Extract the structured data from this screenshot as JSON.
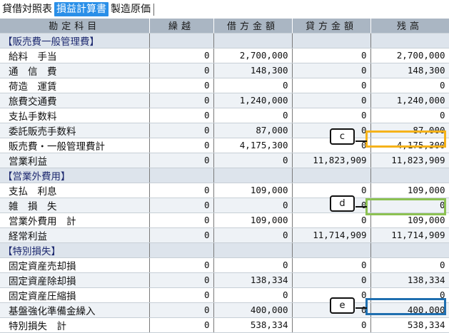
{
  "tabs": [
    {
      "label": "貸借対照表",
      "active": false
    },
    {
      "label": "損益計算書",
      "active": true
    },
    {
      "label": "製造原価",
      "active": false
    }
  ],
  "columns": [
    "勘定科目",
    "繰越",
    "借方金額",
    "貸方金額",
    "残高"
  ],
  "rows": [
    {
      "type": "section",
      "label": "【販売費一般管理費】"
    },
    {
      "label": "給料　手当",
      "c1": "0",
      "c2": "2,700,000",
      "c3": "0",
      "c4": "2,700,000"
    },
    {
      "label": "通　信　費",
      "c1": "0",
      "c2": "148,300",
      "c3": "0",
      "c4": "148,300"
    },
    {
      "label": "荷造　運賃",
      "c1": "0",
      "c2": "0",
      "c3": "0",
      "c4": "0"
    },
    {
      "label": "旅費交通費",
      "c1": "0",
      "c2": "1,240,000",
      "c3": "0",
      "c4": "1,240,000"
    },
    {
      "label": "支払手数料",
      "c1": "0",
      "c2": "0",
      "c3": "0",
      "c4": "0"
    },
    {
      "label": "委託販売手数料",
      "c1": "0",
      "c2": "87,000",
      "c3": "0",
      "c4": "87,000"
    },
    {
      "label": "販売費・一般管理費計",
      "c1": "0",
      "c2": "4,175,300",
      "c3": "0",
      "c4": "4,175,300"
    },
    {
      "label": "営業利益",
      "c1": "0",
      "c2": "0",
      "c3": "11,823,909",
      "c4": "11,823,909"
    },
    {
      "type": "section",
      "label": "【営業外費用】"
    },
    {
      "label": "支払　利息",
      "c1": "0",
      "c2": "109,000",
      "c3": "0",
      "c4": "109,000"
    },
    {
      "label": "雑　損　失",
      "c1": "0",
      "c2": "0",
      "c3": "0",
      "c4": "0"
    },
    {
      "label": "営業外費用　計",
      "c1": "0",
      "c2": "109,000",
      "c3": "0",
      "c4": "109,000"
    },
    {
      "label": "経常利益",
      "c1": "0",
      "c2": "0",
      "c3": "11,714,909",
      "c4": "11,714,909"
    },
    {
      "type": "section",
      "label": "【特別損失】"
    },
    {
      "label": "固定資産売却損",
      "c1": "0",
      "c2": "0",
      "c3": "0",
      "c4": "0"
    },
    {
      "label": "固定資産除却損",
      "c1": "0",
      "c2": "138,334",
      "c3": "0",
      "c4": "138,334"
    },
    {
      "label": "固定資産圧縮損",
      "c1": "0",
      "c2": "0",
      "c3": "0",
      "c4": "0"
    },
    {
      "label": "基盤強化準備金繰入",
      "c1": "0",
      "c2": "400,000",
      "c3": "0",
      "c4": "400,000"
    },
    {
      "label": "特別損失　計",
      "c1": "0",
      "c2": "538,334",
      "c3": "0",
      "c4": "538,334"
    }
  ],
  "annotations": [
    {
      "label": "c",
      "color": "#f5b21a"
    },
    {
      "label": "d",
      "color": "#8cc152"
    },
    {
      "label": "e",
      "color": "#1f6fb0"
    }
  ]
}
